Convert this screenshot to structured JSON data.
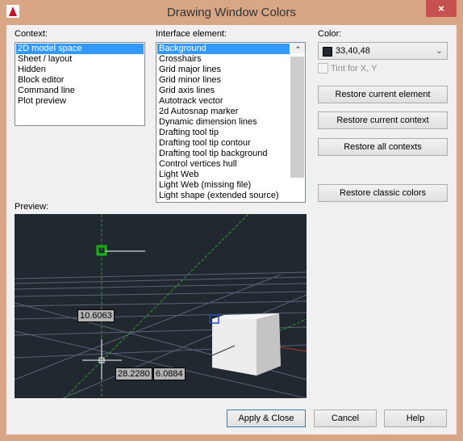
{
  "window": {
    "title": "Drawing Window Colors",
    "close_label": "×"
  },
  "context": {
    "label": "Context:",
    "items": [
      "2D model space",
      "Sheet / layout",
      "Hidden",
      "Block editor",
      "Command line",
      "Plot preview"
    ],
    "selected": "2D model space"
  },
  "interface": {
    "label": "Interface element:",
    "items": [
      "Background",
      "Crosshairs",
      "Grid major lines",
      "Grid minor lines",
      "Grid axis lines",
      "Autotrack vector",
      "2d Autosnap marker",
      "Dynamic dimension lines",
      "Drafting tool tip",
      "Drafting tool tip contour",
      "Drafting tool tip background",
      "Control vertices hull",
      "Light Web",
      "Light Web (missing file)",
      "Light shape (extended source)"
    ],
    "selected": "Background"
  },
  "color": {
    "label": "Color:",
    "value": "33,40,48",
    "swatch": "#21282f",
    "tint_label": "Tint for X, Y",
    "tint_checked": false
  },
  "buttons": {
    "restore_element": "Restore current element",
    "restore_context": "Restore current context",
    "restore_all": "Restore all contexts",
    "restore_classic": "Restore classic colors",
    "apply": "Apply & Close",
    "cancel": "Cancel",
    "help": "Help"
  },
  "preview": {
    "label": "Preview:",
    "dim1": "10.6063",
    "dim2": "28.2280",
    "dim3": "6.0884"
  }
}
